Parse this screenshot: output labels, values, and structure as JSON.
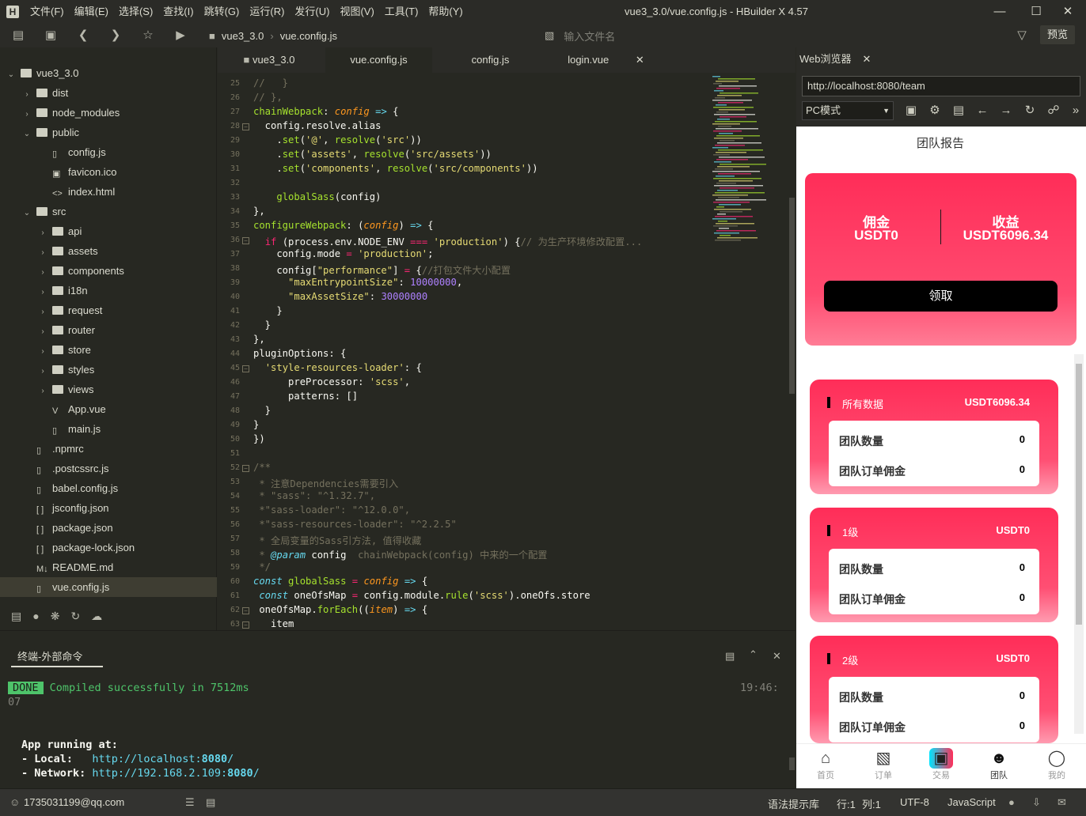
{
  "titlebar": {
    "menus": [
      "文件(F)",
      "编辑(E)",
      "选择(S)",
      "查找(I)",
      "跳转(G)",
      "运行(R)",
      "发行(U)",
      "视图(V)",
      "工具(T)",
      "帮助(Y)"
    ],
    "title": "vue3_3.0/vue.config.js - HBuilder X 4.57"
  },
  "toolbar": {
    "crumbs": [
      "vue3_3.0",
      "vue.config.js"
    ],
    "file_input_placeholder": "输入文件名",
    "preview_label": "预览"
  },
  "sidebar": {
    "items": [
      {
        "label": "vue3_3.0",
        "type": "folder",
        "depth": 0,
        "open": true
      },
      {
        "label": "dist",
        "type": "folder",
        "depth": 1,
        "open": false
      },
      {
        "label": "node_modules",
        "type": "folder",
        "depth": 1,
        "open": false
      },
      {
        "label": "public",
        "type": "folder",
        "depth": 1,
        "open": true
      },
      {
        "label": "config.js",
        "type": "file",
        "depth": 2
      },
      {
        "label": "favicon.ico",
        "type": "image",
        "depth": 2
      },
      {
        "label": "index.html",
        "type": "html",
        "depth": 2
      },
      {
        "label": "src",
        "type": "folder",
        "depth": 1,
        "open": true
      },
      {
        "label": "api",
        "type": "folder",
        "depth": 2,
        "open": false
      },
      {
        "label": "assets",
        "type": "folder",
        "depth": 2,
        "open": false
      },
      {
        "label": "components",
        "type": "folder",
        "depth": 2,
        "open": false
      },
      {
        "label": "i18n",
        "type": "folder",
        "depth": 2,
        "open": false
      },
      {
        "label": "request",
        "type": "folder",
        "depth": 2,
        "open": false
      },
      {
        "label": "router",
        "type": "folder",
        "depth": 2,
        "open": false
      },
      {
        "label": "store",
        "type": "folder",
        "depth": 2,
        "open": false
      },
      {
        "label": "styles",
        "type": "folder",
        "depth": 2,
        "open": false
      },
      {
        "label": "views",
        "type": "folder",
        "depth": 2,
        "open": false
      },
      {
        "label": "App.vue",
        "type": "vue",
        "depth": 2
      },
      {
        "label": "main.js",
        "type": "file",
        "depth": 2
      },
      {
        "label": ".npmrc",
        "type": "file",
        "depth": 1
      },
      {
        "label": ".postcssrc.js",
        "type": "file",
        "depth": 1
      },
      {
        "label": "babel.config.js",
        "type": "file",
        "depth": 1
      },
      {
        "label": "jsconfig.json",
        "type": "json",
        "depth": 1
      },
      {
        "label": "package.json",
        "type": "json",
        "depth": 1
      },
      {
        "label": "package-lock.json",
        "type": "json",
        "depth": 1
      },
      {
        "label": "README.md",
        "type": "md",
        "depth": 1
      },
      {
        "label": "vue.config.js",
        "type": "file",
        "depth": 1,
        "selected": true
      }
    ]
  },
  "editor": {
    "tabs": [
      "vue3_3.0",
      "vue.config.js",
      "config.js",
      "login.vue"
    ],
    "active_tab": "vue.config.js"
  },
  "code_lines": [
    {
      "n": "25",
      "h": "<span class='c'>//   }</span>"
    },
    {
      "n": "26",
      "h": "<span class='c'>// },</span>"
    },
    {
      "n": "27",
      "h": "<span class='f'>chainWebpack</span>: <span class='p'>config</span> <span class='k'>=&gt;</span> {"
    },
    {
      "n": "28",
      "h": "  config.resolve.alias",
      "fold": true
    },
    {
      "n": "29",
      "h": "    .<span class='f'>set</span>(<span class='s'>'@'</span>, <span class='f'>resolve</span>(<span class='s'>'src'</span>))"
    },
    {
      "n": "30",
      "h": "    .<span class='f'>set</span>(<span class='s'>'assets'</span>, <span class='f'>resolve</span>(<span class='s'>'src/assets'</span>))"
    },
    {
      "n": "31",
      "h": "    .<span class='f'>set</span>(<span class='s'>'components'</span>, <span class='f'>resolve</span>(<span class='s'>'src/components'</span>))"
    },
    {
      "n": "32",
      "h": ""
    },
    {
      "n": "33",
      "h": "    <span class='f'>globalSass</span>(config)"
    },
    {
      "n": "34",
      "h": "},"
    },
    {
      "n": "35",
      "h": "<span class='f'>configureWebpack</span>: (<span class='p'>config</span>) <span class='k'>=&gt;</span> {"
    },
    {
      "n": "36",
      "h": "  <span class='o'>if</span> (process.env.NODE_ENV <span class='o'>===</span> <span class='s'>'production'</span>) {<span class='c'>// 为生产环境修改配置...</span>",
      "fold": true
    },
    {
      "n": "37",
      "h": "    config.mode <span class='o'>=</span> <span class='s'>'production'</span>;"
    },
    {
      "n": "38",
      "h": "    config[<span class='s'>\"performance\"</span>] <span class='o'>=</span> {<span class='c'>//打包文件大小配置</span>"
    },
    {
      "n": "39",
      "h": "      <span class='s'>\"maxEntrypointSize\"</span>: <span class='n'>10000000</span>,"
    },
    {
      "n": "40",
      "h": "      <span class='s'>\"maxAssetSize\"</span>: <span class='n'>30000000</span>"
    },
    {
      "n": "41",
      "h": "    }"
    },
    {
      "n": "42",
      "h": "  }"
    },
    {
      "n": "43",
      "h": "},"
    },
    {
      "n": "44",
      "h": "pluginOptions: {"
    },
    {
      "n": "45",
      "h": "  <span class='s'>'style-resources-loader'</span>: {",
      "fold": true
    },
    {
      "n": "46",
      "h": "      preProcessor: <span class='s'>'scss'</span>,"
    },
    {
      "n": "47",
      "h": "      patterns: []"
    },
    {
      "n": "48",
      "h": "  }"
    },
    {
      "n": "49",
      "h": "}"
    },
    {
      "n": "50",
      "h": "})"
    },
    {
      "n": "51",
      "h": ""
    },
    {
      "n": "52",
      "h": "<span class='c'>/**</span>",
      "fold": true
    },
    {
      "n": "53",
      "h": "<span class='c'> * 注意Dependencies需要引入</span>"
    },
    {
      "n": "54",
      "h": "<span class='c'> * \"sass\": \"^1.32.7\",</span>"
    },
    {
      "n": "55",
      "h": "<span class='c'> *\"sass-loader\": \"^12.0.0\",</span>"
    },
    {
      "n": "56",
      "h": "<span class='c'> *\"sass-resources-loader\": \"^2.2.5\"</span>"
    },
    {
      "n": "57",
      "h": "<span class='c'> * 全局变量的Sass引方法, 值得收藏</span>"
    },
    {
      "n": "58",
      "h": "<span class='c'> * </span><span class='it'>@param</span> config  <span class='c'>chainWebpack(config) 中来的一个配置</span>"
    },
    {
      "n": "59",
      "h": "<span class='c'> */</span>"
    },
    {
      "n": "60",
      "h": "<span class='it'>const</span> <span class='f'>globalSass</span> <span class='o'>=</span> <span class='p'>config</span> <span class='k'>=&gt;</span> {"
    },
    {
      "n": "61",
      "h": " <span class='it'>const</span> oneOfsMap <span class='o'>=</span> config.module.<span class='f'>rule</span>(<span class='s'>'scss'</span>).oneOfs.store"
    },
    {
      "n": "62",
      "h": " oneOfsMap.<span class='f'>forEach</span>((<span class='p'>item</span>) <span class='k'>=&gt;</span> {",
      "fold": true
    },
    {
      "n": "63",
      "h": "   item",
      "fold": true
    }
  ],
  "terminal": {
    "tab_label": "终端-外部命令",
    "done_badge": "DONE",
    "compiled_msg": "Compiled successfully in 7512ms",
    "time": "19:46:",
    "time2": "07",
    "app_running": "App running at:",
    "local_label": "- Local:   ",
    "local_url": "http://localhost:",
    "local_port": "8080",
    "network_label": "- Network: ",
    "network_url": "http://192.168.2.109:",
    "network_port": "8080"
  },
  "status": {
    "email": "1735031199@qq.com",
    "hint": "语法提示库",
    "line": "行:1",
    "col": "列:1",
    "encoding": "UTF-8",
    "language": "JavaScript"
  },
  "browser": {
    "tab_label": "Web浏览器",
    "url": "http://localhost:8080/team",
    "mode": "PC模式",
    "page_title": "团队报告",
    "hero": {
      "commission_label": "佣金",
      "commission_value": "USDT0",
      "income_label": "收益",
      "income_value": "USDT6096.34",
      "claim_label": "领取"
    },
    "cards": [
      {
        "title": "所有数据",
        "value": "USDT6096.34",
        "row1": "团队数量",
        "row1_val": "0",
        "row2": "团队订单佣金",
        "row2_val": "0"
      },
      {
        "title": "1级",
        "value": "USDT0",
        "row1": "团队数量",
        "row1_val": "0",
        "row2": "团队订单佣金",
        "row2_val": "0"
      },
      {
        "title": "2级",
        "value": "USDT0",
        "row1": "团队数量",
        "row1_val": "0",
        "row2": "团队订单佣金",
        "row2_val": "0"
      }
    ],
    "tabbar": [
      "首页",
      "订单",
      "交易",
      "团队",
      "我的"
    ]
  },
  "colors": {
    "accent_pink": "#ff2d58",
    "terminal_done": "#4ec46a",
    "editor_bg": "#272822"
  }
}
